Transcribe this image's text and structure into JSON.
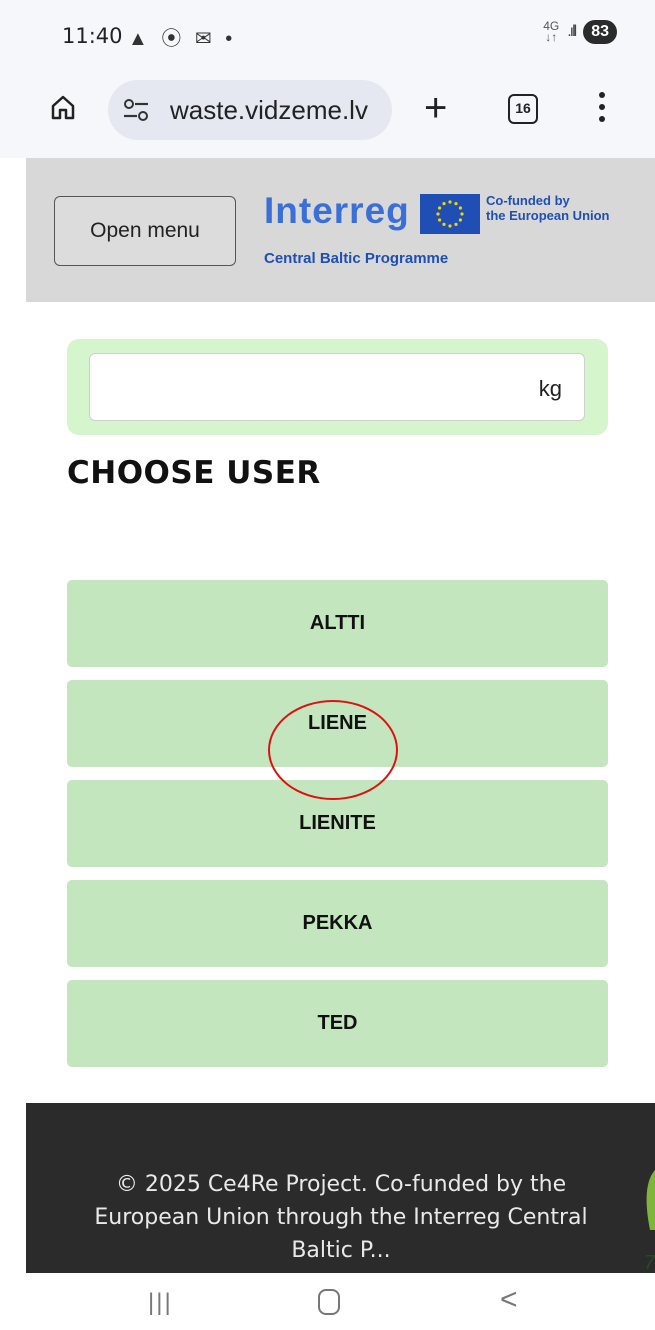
{
  "status_bar": {
    "time": "11:40",
    "notification_icons": "▲ ⦿ ✉ •",
    "network": "4G",
    "battery": "83"
  },
  "browser": {
    "url": "waste.vidzeme.lv",
    "tab_count": "16"
  },
  "header": {
    "open_menu_label": "Open menu",
    "logo_word": "Interreg",
    "cofunded_line1": "Co-funded by",
    "cofunded_line2": "the European Union",
    "programme": "Central Baltic Programme"
  },
  "weight_input": {
    "value": "",
    "unit": "kg"
  },
  "choose_user": {
    "title": "CHOOSE USER",
    "users": [
      "ALTTI",
      "LIENE",
      "LIENITE",
      "PEKKA",
      "TED"
    ]
  },
  "footer": {
    "text": "© 2025 Ce4Re Project. Co-funded by the European Union through the Interreg Central Baltic P..."
  },
  "edge_number": "7",
  "colors": {
    "user_button": "#c3e6bf",
    "weight_card": "#d5f5cc",
    "footer_bg": "#2b2b2b",
    "highlight": "#e01010",
    "brand_blue": "#1f4fb5"
  }
}
